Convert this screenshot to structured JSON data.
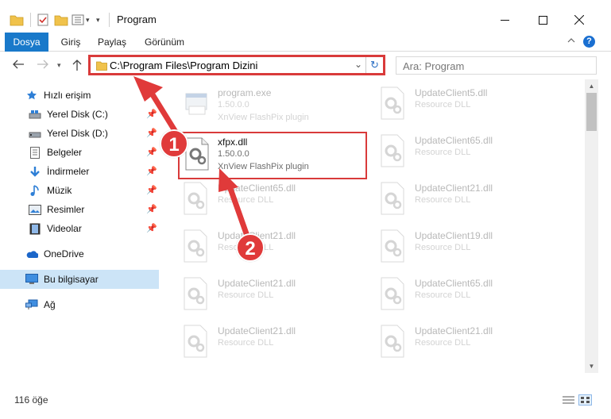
{
  "window": {
    "title": "Program",
    "controls": {
      "minimize": "—",
      "maximize": "☐",
      "close": "✕"
    }
  },
  "ribbon": {
    "tabs": [
      {
        "label": "Dosya"
      },
      {
        "label": "Giriş"
      },
      {
        "label": "Paylaş"
      },
      {
        "label": "Görünüm"
      }
    ],
    "help": "?"
  },
  "nav": {
    "address": "C:\\Program Files\\Program Dizini",
    "search_placeholder": "Ara: Program"
  },
  "sidebar": {
    "items": [
      {
        "label": "Hızlı erişim",
        "icon": "star-icon",
        "pinned": false
      },
      {
        "label": "Yerel Disk (C:)",
        "icon": "drive-icon",
        "pinned": true
      },
      {
        "label": "Yerel Disk (D:)",
        "icon": "drive-icon",
        "pinned": true
      },
      {
        "label": "Belgeler",
        "icon": "document-icon",
        "pinned": true
      },
      {
        "label": "İndirmeler",
        "icon": "download-icon",
        "pinned": true
      },
      {
        "label": "Müzik",
        "icon": "music-icon",
        "pinned": true
      },
      {
        "label": "Resimler",
        "icon": "pictures-icon",
        "pinned": true
      },
      {
        "label": "Videolar",
        "icon": "video-icon",
        "pinned": true
      },
      {
        "label": "OneDrive",
        "icon": "cloud-icon",
        "pinned": false
      },
      {
        "label": "Bu bilgisayar",
        "icon": "computer-icon",
        "pinned": false,
        "selected": true
      },
      {
        "label": "Ağ",
        "icon": "network-icon",
        "pinned": false
      }
    ]
  },
  "files": [
    {
      "name": "program.exe",
      "line1": "1.50.0.0",
      "line2": "XnView FlashPix plugin",
      "faded": true,
      "kind": "exe"
    },
    {
      "name": "UpdateClient5.dll",
      "line1": "Resource DLL",
      "line2": "",
      "faded": true,
      "kind": "dll"
    },
    {
      "name": "xfpx.dll",
      "line1": "1.50.0.0",
      "line2": "XnView FlashPix plugin",
      "faded": false,
      "highlight": true,
      "kind": "dll"
    },
    {
      "name": "UpdateClient65.dll",
      "line1": "Resource DLL",
      "line2": "",
      "faded": true,
      "kind": "dll"
    },
    {
      "name": "UpdateClient65.dll",
      "line1": "Resource DLL",
      "line2": "",
      "faded": true,
      "kind": "dll"
    },
    {
      "name": "UpdateClient21.dll",
      "line1": "Resource DLL",
      "line2": "",
      "faded": true,
      "kind": "dll"
    },
    {
      "name": "UpdateClient21.dll",
      "line1": "Resource DLL",
      "line2": "",
      "faded": true,
      "kind": "dll"
    },
    {
      "name": "UpdateClient19.dll",
      "line1": "Resource DLL",
      "line2": "",
      "faded": true,
      "kind": "dll"
    },
    {
      "name": "UpdateClient21.dll",
      "line1": "Resource DLL",
      "line2": "",
      "faded": true,
      "kind": "dll"
    },
    {
      "name": "UpdateClient65.dll",
      "line1": "Resource DLL",
      "line2": "",
      "faded": true,
      "kind": "dll"
    },
    {
      "name": "UpdateClient21.dll",
      "line1": "Resource DLL",
      "line2": "",
      "faded": true,
      "kind": "dll"
    },
    {
      "name": "UpdateClient21.dll",
      "line1": "Resource DLL",
      "line2": "",
      "faded": true,
      "kind": "dll"
    }
  ],
  "status": {
    "count": "116 öğe"
  },
  "annotations": {
    "step1": "1",
    "step2": "2",
    "color": "#e03a3a"
  },
  "colors": {
    "accent": "#1979ca",
    "highlight_border": "#d93a3a",
    "selected_bg": "#cce4f7"
  }
}
